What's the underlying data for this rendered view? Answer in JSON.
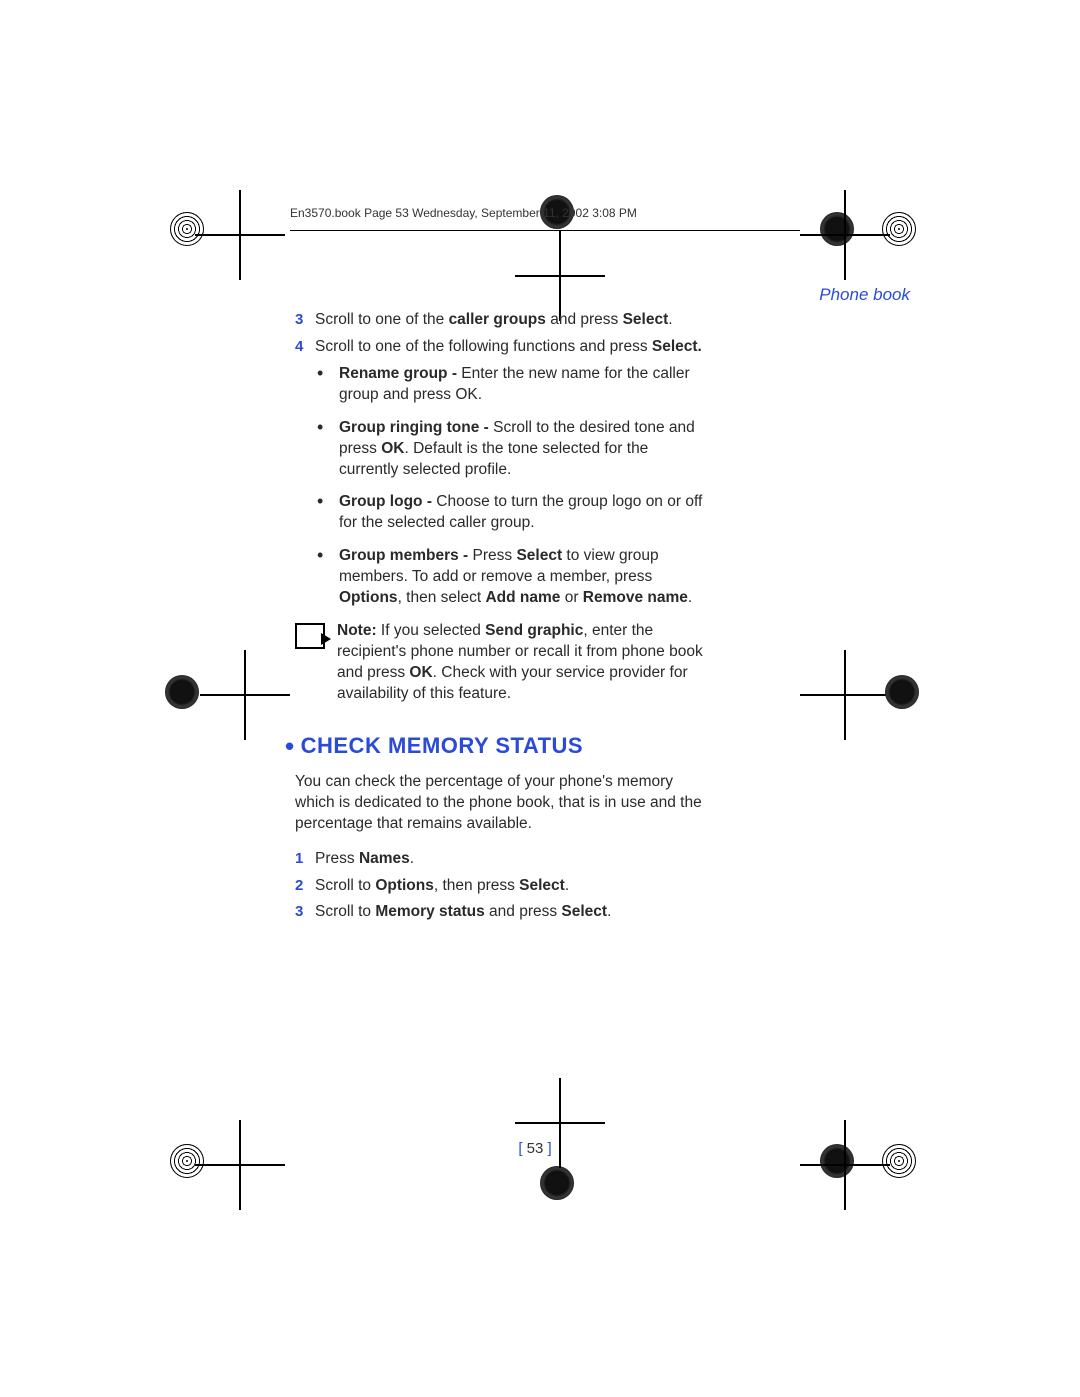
{
  "meta_line": "En3570.book  Page 53  Wednesday, September 11, 2002  3:08 PM",
  "section_header": "Phone book",
  "step3": {
    "num": "3",
    "t1": "Scroll to one of the ",
    "b1": "caller groups",
    "t2": " and press ",
    "b2": "Select",
    "t3": "."
  },
  "step4": {
    "num": "4",
    "t1": "Scroll to one of the following functions and press ",
    "b1": "Select.",
    "t2": ""
  },
  "bul1": {
    "b1": "Rename group - ",
    "t1": "Enter the new name for the caller group and press OK."
  },
  "bul2": {
    "b1": "Group ringing tone - ",
    "t1": "Scroll to the desired tone and press ",
    "b2": "OK",
    "t2": ". Default is the tone selected for the currently selected profile."
  },
  "bul3": {
    "b1": "Group logo - ",
    "t1": "Choose to turn the group logo on or off for the selected caller group."
  },
  "bul4": {
    "b1": "Group members - ",
    "t1": "Press ",
    "b2": "Select",
    "t2": " to view group members. To add or remove a member, press ",
    "b3": "Options",
    "t3": ", then select ",
    "b4": "Add name",
    "t4": " or ",
    "b5": "Remove name",
    "t5": "."
  },
  "note": {
    "b1": "Note:",
    "t1": " If you selected ",
    "b2": "Send graphic",
    "t2": ", enter the recipient's phone number or recall it from phone book and press ",
    "b3": "OK",
    "t3": ". Check with your service provider for availability of this feature."
  },
  "h2": "CHECK MEMORY STATUS",
  "para": "You can check the percentage of your phone's memory which is dedicated to the phone book, that is in use and the percentage that remains available.",
  "m1": {
    "num": "1",
    "t1": "Press ",
    "b1": "Names",
    "t2": "."
  },
  "m2": {
    "num": "2",
    "t1": "Scroll to ",
    "b1": "Options",
    "t2": ", then press ",
    "b2": "Select",
    "t3": "."
  },
  "m3": {
    "num": "3",
    "t1": "Scroll to ",
    "b1": "Memory status",
    "t2": " and press ",
    "b2": "Select",
    "t3": "."
  },
  "page_num": {
    "l": "[ ",
    "n": "53",
    "r": " ]"
  }
}
